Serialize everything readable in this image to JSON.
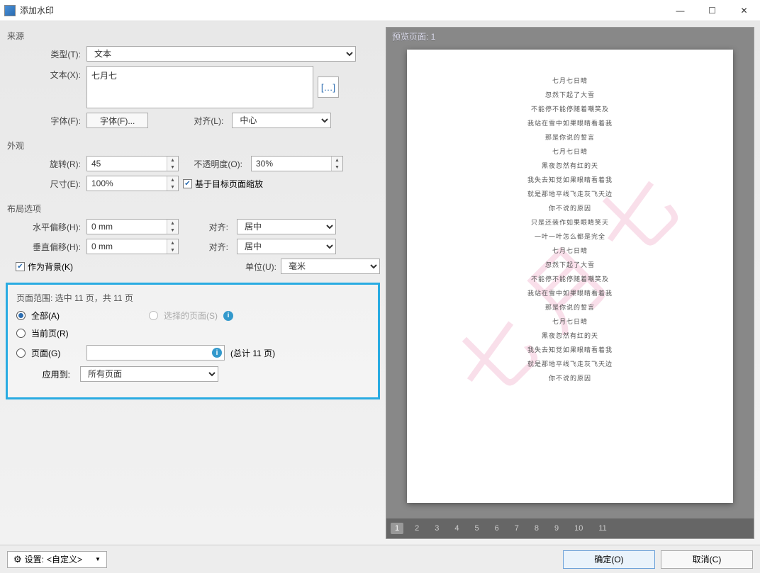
{
  "window": {
    "title": "添加水印"
  },
  "source": {
    "group": "来源",
    "type_label": "类型(T):",
    "type_value": "文本",
    "text_label": "文本(X):",
    "text_value": "七月七",
    "macro_tooltip": "[…]",
    "font_label": "字体(F):",
    "font_button": "字体(F)...",
    "align_label": "对齐(L):",
    "align_value": "中心"
  },
  "appearance": {
    "group": "外观",
    "rotate_label": "旋转(R):",
    "rotate_value": "45",
    "opacity_label": "不透明度(O):",
    "opacity_value": "30%",
    "size_label": "尺寸(E):",
    "size_value": "100%",
    "scale_checkbox": "基于目标页面缩放"
  },
  "layout": {
    "group": "布局选项",
    "hoffset_label": "水平偏移(H):",
    "hoffset_value": "0 mm",
    "halign_label": "对齐:",
    "halign_value": "居中",
    "voffset_label": "垂直偏移(H):",
    "voffset_value": "0 mm",
    "valign_label": "对齐:",
    "valign_value": "居中",
    "as_bg_checkbox": "作为背景(K)",
    "unit_label": "单位(U):",
    "unit_value": "毫米"
  },
  "range": {
    "title": "页面范围: 选中 11 页，共 11 页",
    "all": "全部(A)",
    "selected": "选择的页面(S)",
    "current": "当前页(R)",
    "pages": "页面(G)",
    "total": "(总计 11 页)",
    "apply_label": "应用到:",
    "apply_value": "所有页面"
  },
  "preview": {
    "header": "预览页面: 1",
    "watermark_text": "七月七",
    "lines": [
      "七月七日晴",
      "忽然下起了大雪",
      "不能停不能停随着嘲笑及",
      "我站在雪中如果眼睛看着我",
      "那是你说的誓言",
      "七月七日晴",
      "黑夜忽然有红的天",
      "我失去知觉如果眼睛看着我",
      "就是那地平线飞走灰飞天边",
      "你不说的原因",
      "只是还装作如果眼睛笑天",
      "一叶一叶怎么都是完全",
      "七月七日晴",
      "忽然下起了大雪",
      "不能停不能停随着嘲笑及",
      "我站在雪中如果眼睛看着我",
      "那是你说的誓言",
      "七月七日晴",
      "黑夜忽然有红的天",
      "我失去知觉如果眼睛看着我",
      "就是那地平线飞走灰飞天边",
      "你不说的原因"
    ],
    "pages": [
      "1",
      "2",
      "3",
      "4",
      "5",
      "6",
      "7",
      "8",
      "9",
      "10",
      "11"
    ]
  },
  "footer": {
    "settings_label": "设置:",
    "settings_value": "<自定义>",
    "ok": "确定(O)",
    "cancel": "取消(C)"
  }
}
